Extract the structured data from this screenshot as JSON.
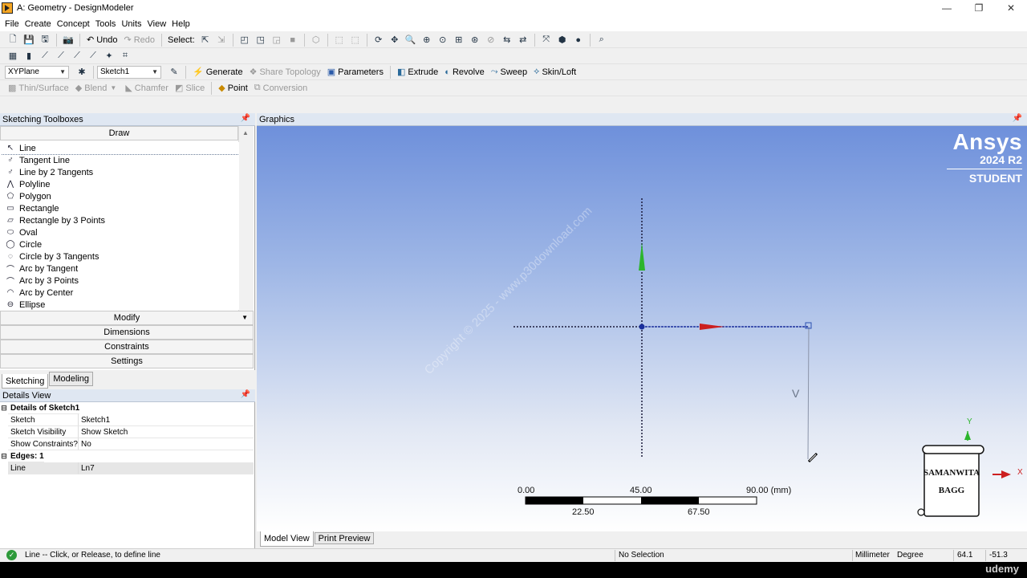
{
  "window": {
    "title": "A: Geometry - DesignModeler",
    "minimize": "—",
    "restore": "❐",
    "close": "✕"
  },
  "menu": [
    "File",
    "Create",
    "Concept",
    "Tools",
    "Units",
    "View",
    "Help"
  ],
  "toolbar1": {
    "undo": "Undo",
    "redo": "Redo",
    "select": "Select:"
  },
  "toolbar3": {
    "plane": "XYPlane",
    "sketch": "Sketch1",
    "generate": "Generate",
    "share_topology": "Share Topology",
    "parameters": "Parameters",
    "extrude": "Extrude",
    "revolve": "Revolve",
    "sweep": "Sweep",
    "skin_loft": "Skin/Loft"
  },
  "toolbar4": {
    "thin_surface": "Thin/Surface",
    "blend": "Blend",
    "chamfer": "Chamfer",
    "slice": "Slice",
    "point": "Point",
    "conversion": "Conversion"
  },
  "sketching_toolboxes": {
    "title": "Sketching Toolboxes",
    "draw": "Draw",
    "draw_items": [
      {
        "label": "Line",
        "icon": "↖"
      },
      {
        "label": "Tangent Line",
        "icon": "♂"
      },
      {
        "label": "Line by 2 Tangents",
        "icon": "♂"
      },
      {
        "label": "Polyline",
        "icon": "⋀"
      },
      {
        "label": "Polygon",
        "icon": "⬠"
      },
      {
        "label": "Rectangle",
        "icon": "▭"
      },
      {
        "label": "Rectangle by 3 Points",
        "icon": "▱"
      },
      {
        "label": "Oval",
        "icon": "⬭"
      },
      {
        "label": "Circle",
        "icon": "◯"
      },
      {
        "label": "Circle by 3 Tangents",
        "icon": "◌"
      },
      {
        "label": "Arc by Tangent",
        "icon": "⌒"
      },
      {
        "label": "Arc by 3 Points",
        "icon": "⌒"
      },
      {
        "label": "Arc by Center",
        "icon": "◠"
      },
      {
        "label": "Ellipse",
        "icon": "⊖"
      }
    ],
    "modify": "Modify",
    "dimensions": "Dimensions",
    "constraints": "Constraints",
    "settings": "Settings"
  },
  "panel_tabs": {
    "sketching": "Sketching",
    "modeling": "Modeling"
  },
  "details": {
    "title": "Details View",
    "section1": "Details of Sketch1",
    "rows1": [
      {
        "k": "Sketch",
        "v": "Sketch1"
      },
      {
        "k": "Sketch Visibility",
        "v": "Show Sketch"
      },
      {
        "k": "Show Constraints?",
        "v": "No"
      }
    ],
    "section2": "Edges: 1",
    "rows2": [
      {
        "k": "Line",
        "v": "Ln7"
      }
    ]
  },
  "graphics": {
    "title": "Graphics",
    "brand_line1": "Ansys",
    "brand_line2": "2024 R2",
    "brand_line3": "STUDENT",
    "constraint_label": "V",
    "scale_top": [
      "0.00",
      "45.00",
      "90.00 (mm)"
    ],
    "scale_bottom": [
      "22.50",
      "67.50"
    ],
    "triad_y": "Y",
    "triad_x": "X",
    "logo_line1": "SAMANWITA",
    "logo_line2": "BAGG",
    "watermark": "Copyright © 2025 - www.p30download.com"
  },
  "view_tabs": {
    "model_view": "Model View",
    "print_preview": "Print Preview"
  },
  "status": {
    "message": "Line -- Click, or Release, to define line",
    "selection": "No Selection",
    "units_length": "Millimeter",
    "units_angle": "Degree",
    "coord_x": "64.1",
    "coord_y": "-51.3"
  },
  "overlay": {
    "udemy": "udemy"
  },
  "colors": {
    "y_axis": "#2cb52c",
    "x_axis": "#cc1f1f",
    "sketch_line": "#1a2f9c"
  }
}
